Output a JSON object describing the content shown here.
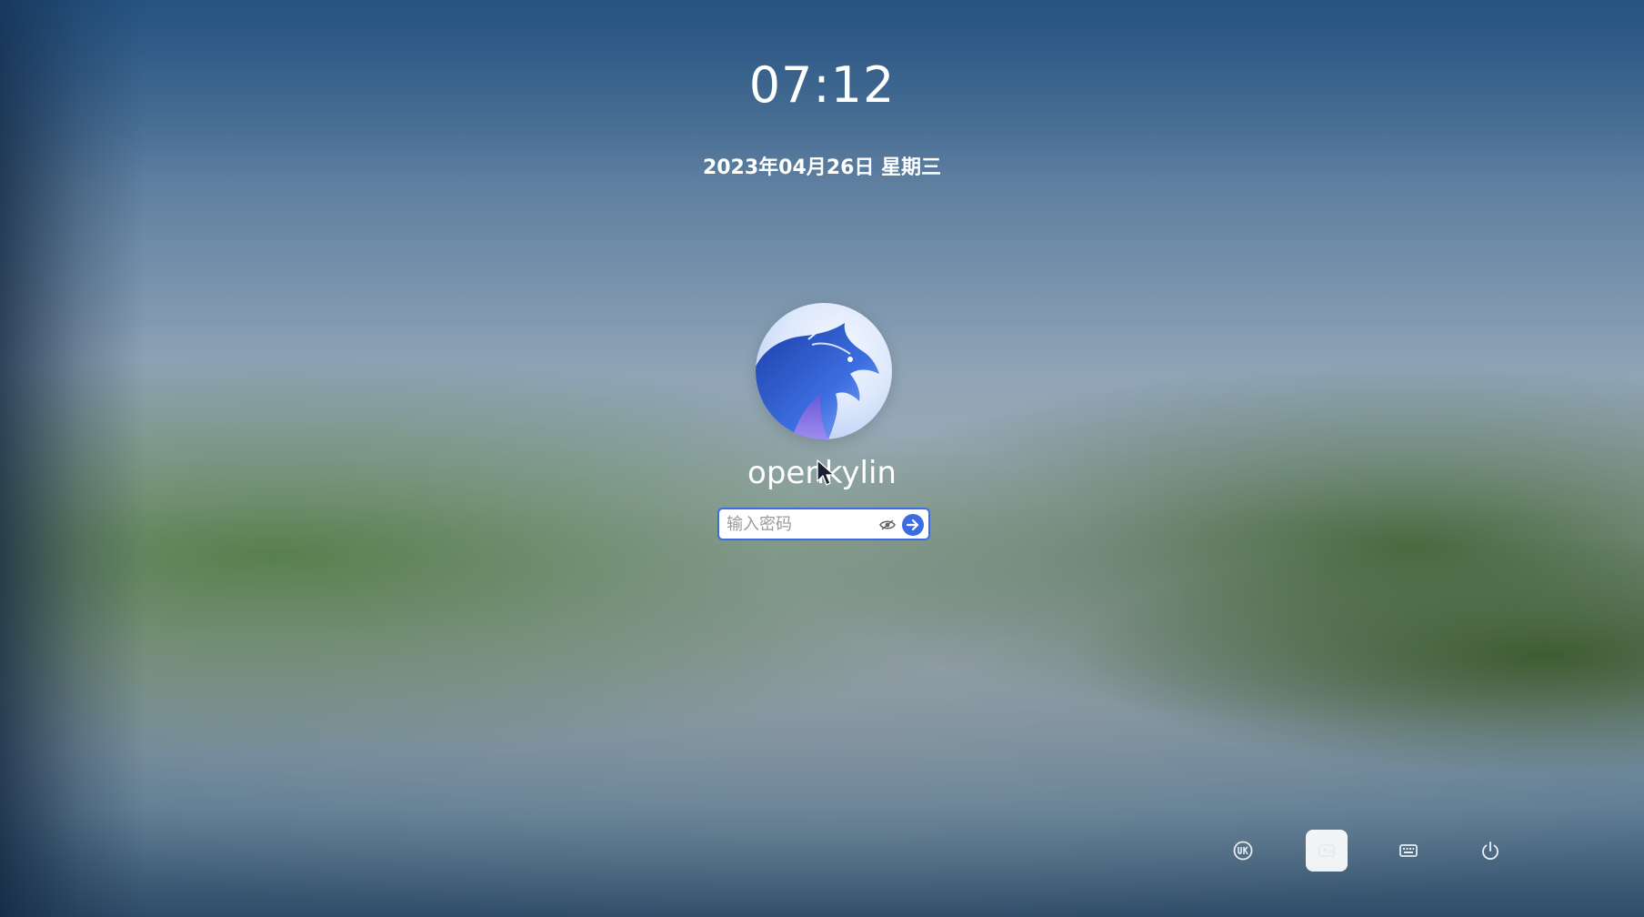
{
  "lock_screen": {
    "time": "07:12",
    "date": "2023年04月26日 星期三"
  },
  "user": {
    "name": "openkylin",
    "avatar_icon": "kylin-dragon-avatar-icon"
  },
  "password_field": {
    "placeholder": "输入密码",
    "value": "",
    "reveal_icon": "eye-icon",
    "submit_icon": "arrow-right-icon",
    "accent_color": "#3d6be3"
  },
  "bottom_tray": {
    "buttons": [
      {
        "icon": "ukui-logo-icon"
      },
      {
        "icon": "switch-user-icon",
        "active": true
      },
      {
        "icon": "keyboard-icon"
      },
      {
        "icon": "power-icon"
      }
    ]
  }
}
